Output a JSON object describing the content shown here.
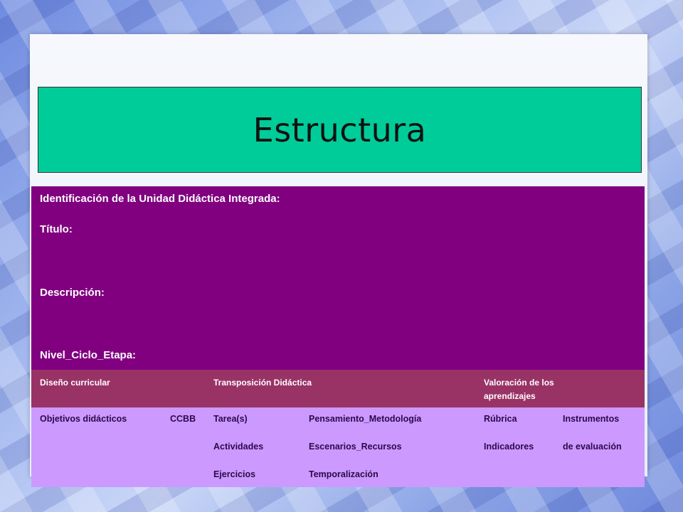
{
  "title": "Estructura",
  "identification": {
    "heading": "Identificación de la Unidad Didáctica Integrada:",
    "titulo": "Título:",
    "descripcion": "Descripción:",
    "nivel": "Nivel_Ciclo_Etapa:"
  },
  "table": {
    "headers": {
      "diseno": "Diseño curricular",
      "transposicion": "Transposición  Didáctica",
      "valoracion_line1": "Valoración  de los",
      "valoracion_line2": "aprendizajes"
    },
    "rows": {
      "objetivos": "Objetivos  didácticos",
      "ccbb": "CCBB",
      "tarea": "Tarea(s)",
      "actividades": "Actividades",
      "ejercicios": "Ejercicios",
      "pensamiento": "Pensamiento_Metodología",
      "escenarios": "Escenarios_Recursos",
      "temporalizacion": "Temporalización",
      "rubrica": "Rúbrica",
      "indicadores": "Indicadores",
      "instrumentos": "Instrumentos",
      "de_evaluacion": "de evaluación"
    }
  },
  "colors": {
    "title_bg": "#00cc99",
    "ident_bg": "#800080",
    "header_bg": "#993366",
    "detail_bg": "#cc99ff"
  }
}
